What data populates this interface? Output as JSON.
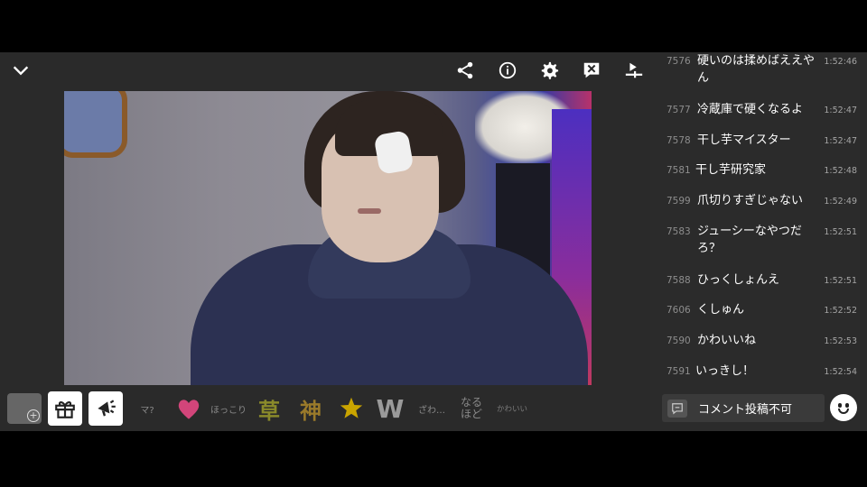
{
  "comments": [
    {
      "num": "7576",
      "text": "硬いのは揉めばええやん",
      "time": "1:52:46"
    },
    {
      "num": "7577",
      "text": "冷蔵庫で硬くなるよ",
      "time": "1:52:47"
    },
    {
      "num": "7578",
      "text": "干し芋マイスター",
      "time": "1:52:47"
    },
    {
      "num": "7581",
      "text": "干し芋研究家",
      "time": "1:52:48"
    },
    {
      "num": "7599",
      "text": "爪切りすぎじゃない",
      "time": "1:52:49"
    },
    {
      "num": "7583",
      "text": "ジューシーなやつだろ？",
      "time": "1:52:51"
    },
    {
      "num": "7588",
      "text": "ひっくしょんえ",
      "time": "1:52:51"
    },
    {
      "num": "7606",
      "text": "くしゅん",
      "time": "1:52:52"
    },
    {
      "num": "7590",
      "text": "かわいいね",
      "time": "1:52:53"
    },
    {
      "num": "7591",
      "text": "いっきし！",
      "time": "1:52:54"
    }
  ],
  "comment_input": {
    "label": "コメント投稿不可"
  },
  "reactions": {
    "ma": "マ?",
    "hokkori": "ほっこり",
    "kusa": "草",
    "kami": "神",
    "w": "W",
    "zawa": "ざわ…",
    "naruhodo_1": "なる",
    "naruhodo_2": "ほど",
    "kawaii": "かわいい"
  },
  "colors": {
    "heart": "#d2457a",
    "star": "#c9a400",
    "kusa": "#8a8a2a",
    "kami": "#9a7a2a"
  },
  "icons": [
    "chevron-down-icon",
    "share-icon",
    "info-icon",
    "gear-icon",
    "comment-off-icon",
    "export-icon",
    "gift-icon",
    "megaphone-icon",
    "smiley-icon"
  ]
}
